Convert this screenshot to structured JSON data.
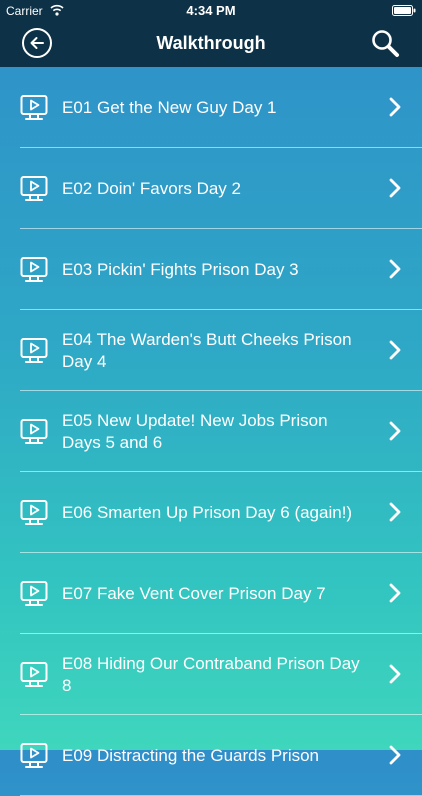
{
  "status_bar": {
    "carrier": "Carrier",
    "time": "4:34 PM"
  },
  "nav": {
    "title": "Walkthrough"
  },
  "icons": {
    "back": "back-arrow-circle-icon",
    "search": "search-icon",
    "item": "video-monitor-icon",
    "chevron": "chevron-right-icon"
  },
  "items": [
    {
      "label": "E01 Get the New Guy Day 1"
    },
    {
      "label": "E02 Doin' Favors Day 2"
    },
    {
      "label": "E03 Pickin' Fights Prison Day 3"
    },
    {
      "label": "E04 The Warden's Butt Cheeks Prison Day 4"
    },
    {
      "label": "E05 New Update! New Jobs Prison Days 5 and 6"
    },
    {
      "label": "E06 Smarten Up Prison Day 6 (again!)"
    },
    {
      "label": "E07 Fake Vent Cover Prison Day 7"
    },
    {
      "label": "E08 Hiding Our Contraband Prison Day 8"
    },
    {
      "label": "E09 Distracting the Guards Prison"
    }
  ]
}
